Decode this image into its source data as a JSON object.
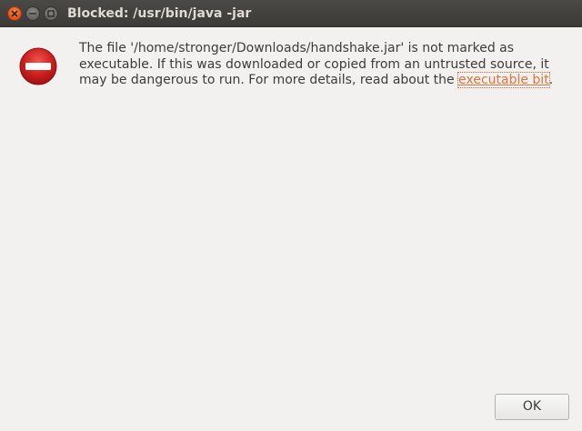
{
  "window": {
    "title": "Blocked: /usr/bin/java -jar"
  },
  "titlebar_buttons": {
    "close": "close-icon",
    "minimize": "minimize-icon",
    "maximize": "maximize-icon"
  },
  "dialog": {
    "icon": "blocked-icon",
    "message_part1": "The file '/home/stronger/Downloads/handshake.jar' is not marked as executable.  If this was downloaded or copied from an untrusted source, it may be dangerous to run.  For more details, read about the ",
    "link_text": "executable bit",
    "message_end": "."
  },
  "buttons": {
    "ok_label": "OK"
  },
  "colors": {
    "titlebar": "#3c3b37",
    "background": "#f2f1f0",
    "close_button": "#e35a1f",
    "link": "#e0743f",
    "blocked_icon": "#cc1f1f"
  }
}
